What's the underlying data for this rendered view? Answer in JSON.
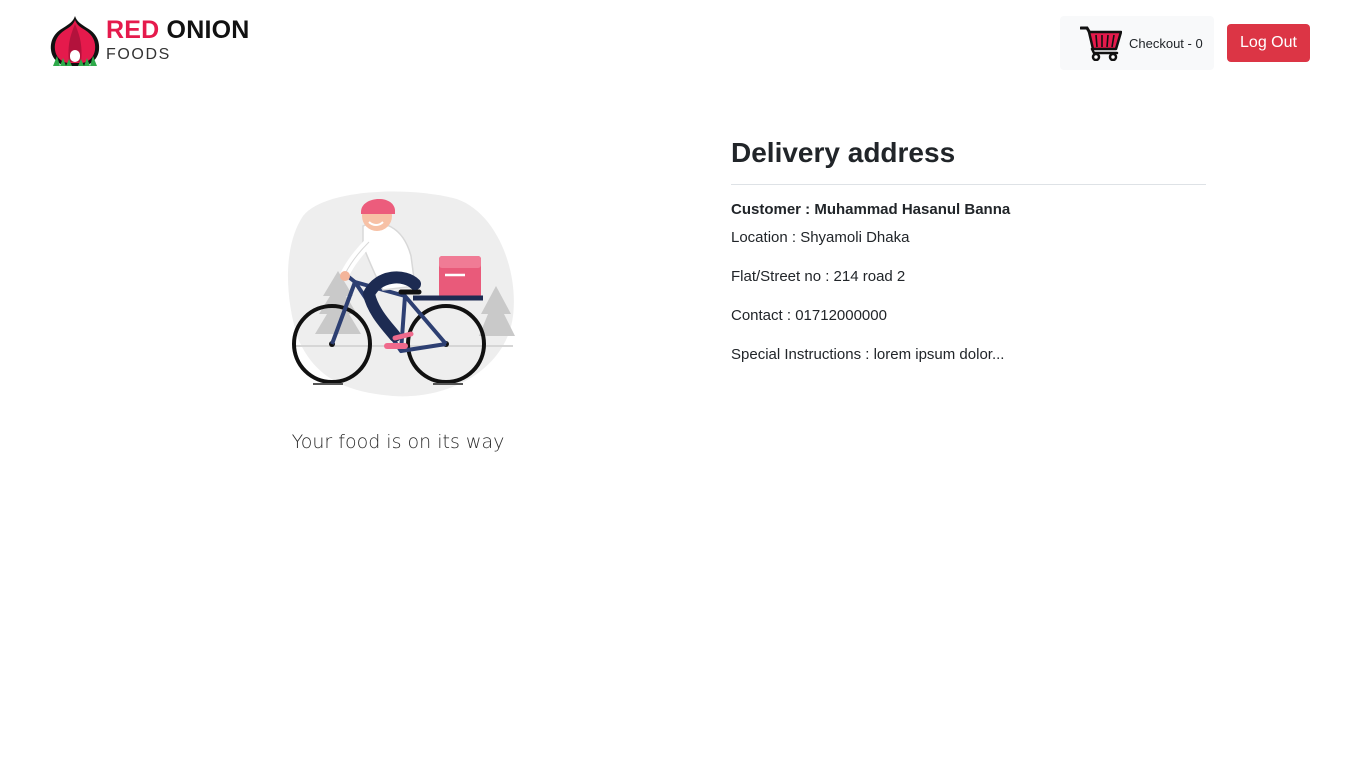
{
  "brand": {
    "name_red": "RED",
    "name_black": "ONION",
    "subtitle": "FOODS",
    "accent_color": "#e51a4c"
  },
  "header": {
    "cart_icon": "cart-icon",
    "checkout_label": "Checkout - 0",
    "logout_label": "Log Out",
    "logout_color": "#dc3545"
  },
  "main": {
    "illustration": "delivery-bicycle-illustration",
    "caption": "Your food is on its way"
  },
  "delivery": {
    "heading": "Delivery address",
    "customer": "Customer : Muhammad Hasanul Banna",
    "location": "Location : Shyamoli Dhaka",
    "flat": "Flat/Street no : 214 road 2",
    "contact": "Contact : 01712000000",
    "instructions": "Special Instructions : lorem ipsum dolor..."
  }
}
